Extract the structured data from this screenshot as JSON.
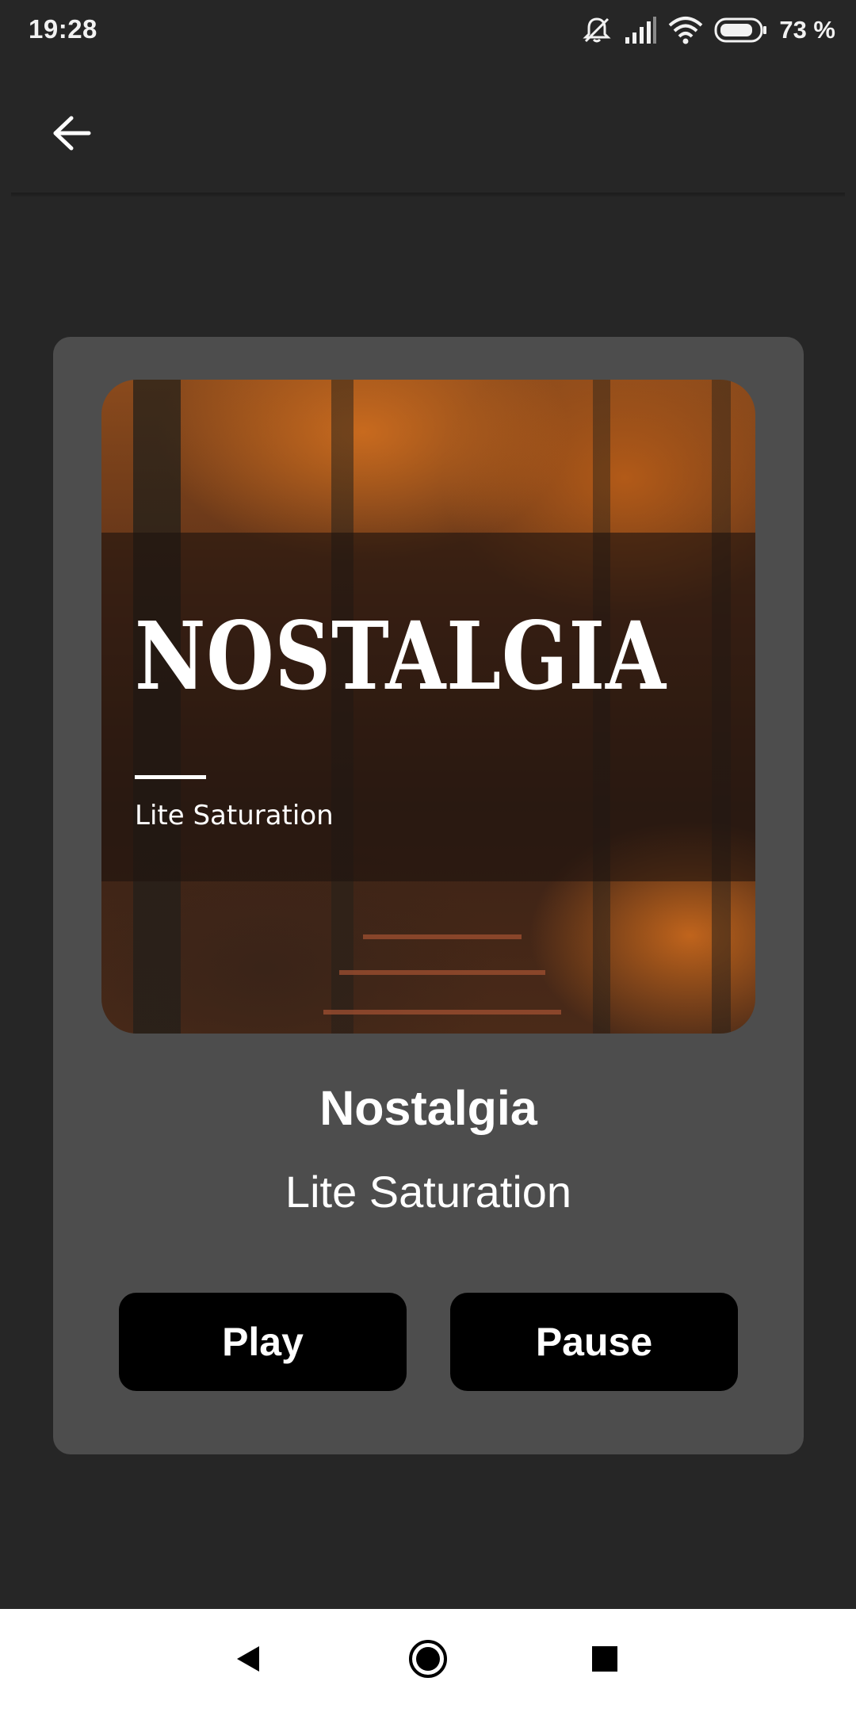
{
  "status_bar": {
    "time": "19:28",
    "battery": "73 %",
    "icons": [
      "notifications-off-icon",
      "signal-icon",
      "wifi-icon",
      "battery-icon"
    ]
  },
  "app_bar": {
    "back_icon": "arrow-left-icon"
  },
  "player": {
    "album_art": {
      "title_text": "NOSTALGIA",
      "subtitle_text": "Lite Saturation"
    },
    "track_title": "Nostalgia",
    "artist": "Lite Saturation",
    "play_label": "Play",
    "pause_label": "Pause"
  },
  "nav_bar": {
    "icons": [
      "back-triangle-icon",
      "home-circle-icon",
      "recents-square-icon"
    ]
  },
  "colors": {
    "background": "#262626",
    "card": "#4d4d4d",
    "button": "#000000",
    "text": "#ffffff",
    "nav_bar": "#ffffff"
  }
}
